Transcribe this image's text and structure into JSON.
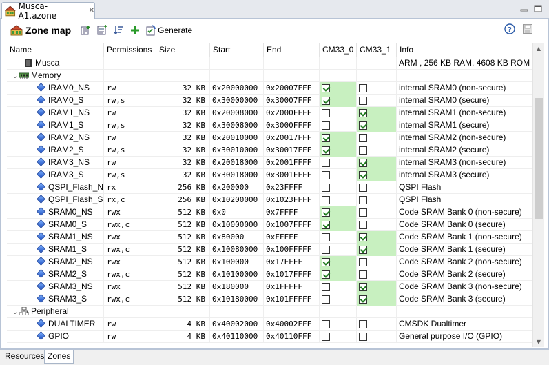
{
  "editor_tab": {
    "title": "Musca-A1.azone"
  },
  "toolbar": {
    "title": "Zone map",
    "generate_label": "Generate"
  },
  "columns": [
    "Name",
    "Permissions",
    "Size",
    "Start",
    "End",
    "CM33_0",
    "CM33_1",
    "Info"
  ],
  "rows": [
    {
      "kind": "device",
      "name": "Musca",
      "perm": "",
      "size": "",
      "start": "",
      "end": "",
      "cm0": null,
      "cm1": null,
      "info": "ARM , 256 KB RAM, 4608 KB ROM"
    },
    {
      "kind": "group",
      "name": "Memory",
      "perm": "",
      "size": "",
      "start": "",
      "end": "",
      "cm0": null,
      "cm1": null,
      "info": ""
    },
    {
      "kind": "item",
      "name": "IRAM0_NS",
      "perm": "rw",
      "size": "32 KB",
      "start": "0x20000000",
      "end": "0x20007FFF",
      "cm0": true,
      "cm1": false,
      "info": "internal SRAM0 (non-secure)"
    },
    {
      "kind": "item",
      "name": "IRAM0_S",
      "perm": "rw,s",
      "size": "32 KB",
      "start": "0x30000000",
      "end": "0x30007FFF",
      "cm0": true,
      "cm1": false,
      "info": "internal SRAM0 (secure)"
    },
    {
      "kind": "item",
      "name": "IRAM1_NS",
      "perm": "rw",
      "size": "32 KB",
      "start": "0x20008000",
      "end": "0x2000FFFF",
      "cm0": false,
      "cm1": true,
      "info": "internal SRAM1 (non-secure)"
    },
    {
      "kind": "item",
      "name": "IRAM1_S",
      "perm": "rw,s",
      "size": "32 KB",
      "start": "0x30008000",
      "end": "0x3000FFFF",
      "cm0": false,
      "cm1": true,
      "info": "internal SRAM1 (secure)"
    },
    {
      "kind": "item",
      "name": "IRAM2_NS",
      "perm": "rw",
      "size": "32 KB",
      "start": "0x20010000",
      "end": "0x20017FFF",
      "cm0": true,
      "cm1": false,
      "info": "internal SRAM2 (non-secure)"
    },
    {
      "kind": "item",
      "name": "IRAM2_S",
      "perm": "rw,s",
      "size": "32 KB",
      "start": "0x30010000",
      "end": "0x30017FFF",
      "cm0": true,
      "cm1": false,
      "info": "internal SRAM2 (secure)"
    },
    {
      "kind": "item",
      "name": "IRAM3_NS",
      "perm": "rw",
      "size": "32 KB",
      "start": "0x20018000",
      "end": "0x2001FFFF",
      "cm0": false,
      "cm1": true,
      "info": "internal SRAM3 (non-secure)"
    },
    {
      "kind": "item",
      "name": "IRAM3_S",
      "perm": "rw,s",
      "size": "32 KB",
      "start": "0x30018000",
      "end": "0x3001FFFF",
      "cm0": false,
      "cm1": true,
      "info": "internal SRAM3 (secure)"
    },
    {
      "kind": "item",
      "name": "QSPI_Flash_NS",
      "perm": "rx",
      "size": "256 KB",
      "start": "0x200000",
      "end": "0x23FFFF",
      "cm0": false,
      "cm1": false,
      "info": "QSPI Flash"
    },
    {
      "kind": "item",
      "name": "QSPI_Flash_S",
      "perm": "rx,c",
      "size": "256 KB",
      "start": "0x10200000",
      "end": "0x1023FFFF",
      "cm0": false,
      "cm1": false,
      "info": "QSPI Flash"
    },
    {
      "kind": "item",
      "name": "SRAM0_NS",
      "perm": "rwx",
      "size": "512 KB",
      "start": "0x0",
      "end": "0x7FFFF",
      "cm0": true,
      "cm1": false,
      "info": "Code SRAM Bank 0 (non-secure)"
    },
    {
      "kind": "item",
      "name": "SRAM0_S",
      "perm": "rwx,c",
      "size": "512 KB",
      "start": "0x10000000",
      "end": "0x1007FFFF",
      "cm0": true,
      "cm1": false,
      "info": "Code SRAM Bank 0 (secure)"
    },
    {
      "kind": "item",
      "name": "SRAM1_NS",
      "perm": "rwx",
      "size": "512 KB",
      "start": "0x80000",
      "end": "0xFFFFF",
      "cm0": false,
      "cm1": true,
      "info": "Code SRAM Bank 1 (non-secure)"
    },
    {
      "kind": "item",
      "name": "SRAM1_S",
      "perm": "rwx,c",
      "size": "512 KB",
      "start": "0x10080000",
      "end": "0x100FFFFF",
      "cm0": false,
      "cm1": true,
      "info": "Code SRAM Bank 1 (secure)"
    },
    {
      "kind": "item",
      "name": "SRAM2_NS",
      "perm": "rwx",
      "size": "512 KB",
      "start": "0x100000",
      "end": "0x17FFFF",
      "cm0": true,
      "cm1": false,
      "info": "Code SRAM Bank 2 (non-secure)"
    },
    {
      "kind": "item",
      "name": "SRAM2_S",
      "perm": "rwx,c",
      "size": "512 KB",
      "start": "0x10100000",
      "end": "0x1017FFFF",
      "cm0": true,
      "cm1": false,
      "info": "Code SRAM Bank 2 (secure)"
    },
    {
      "kind": "item",
      "name": "SRAM3_NS",
      "perm": "rwx",
      "size": "512 KB",
      "start": "0x180000",
      "end": "0x1FFFFF",
      "cm0": false,
      "cm1": true,
      "info": "Code SRAM Bank 3 (non-secure)"
    },
    {
      "kind": "item",
      "name": "SRAM3_S",
      "perm": "rwx,c",
      "size": "512 KB",
      "start": "0x10180000",
      "end": "0x101FFFFF",
      "cm0": false,
      "cm1": true,
      "info": "Code SRAM Bank 3 (secure)"
    },
    {
      "kind": "group2",
      "name": "Peripheral",
      "perm": "",
      "size": "",
      "start": "",
      "end": "",
      "cm0": null,
      "cm1": null,
      "info": ""
    },
    {
      "kind": "periph",
      "name": "DUALTIMER",
      "perm": "rw",
      "size": "4 KB",
      "start": "0x40002000",
      "end": "0x40002FFF",
      "cm0": false,
      "cm1": false,
      "info": "CMSDK Dualtimer"
    },
    {
      "kind": "periph",
      "name": "GPIO",
      "perm": "rw",
      "size": "4 KB",
      "start": "0x40110000",
      "end": "0x40110FFF",
      "cm0": false,
      "cm1": false,
      "info": "General purpose I/O (GPIO)"
    }
  ],
  "bottom_tabs": [
    "Resources",
    "Zones"
  ],
  "active_bottom_tab": "Zones"
}
